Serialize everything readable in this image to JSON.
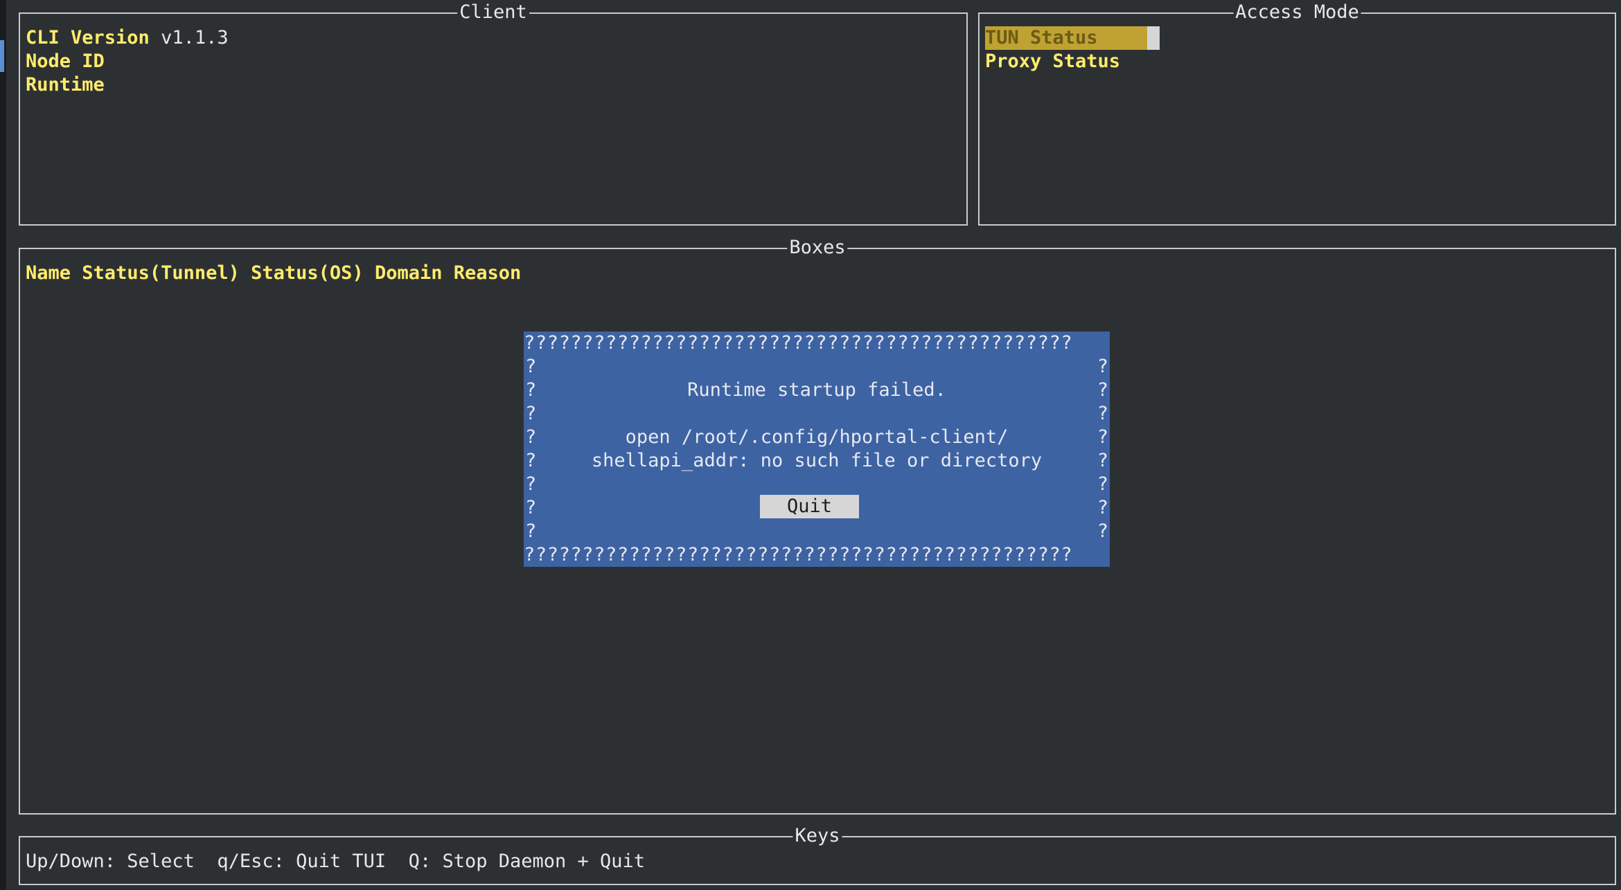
{
  "client": {
    "title": "Client",
    "cli_version_label": "CLI Version",
    "cli_version_value": "v1.1.3",
    "node_id_label": "Node ID",
    "runtime_label": "Runtime"
  },
  "access_mode": {
    "title": "Access Mode",
    "items": [
      {
        "label": "TUN Status"
      },
      {
        "label": "Proxy Status"
      }
    ]
  },
  "boxes": {
    "title": "Boxes",
    "columns": [
      "Name",
      "Status(Tunnel)",
      "Status(OS)",
      "Domain",
      "Reason"
    ]
  },
  "dialog": {
    "border_top": "???????????????????????????????????????????????",
    "border_bottom": "???????????????????????????????????????????????",
    "side_char": "?",
    "message": "Runtime startup failed.",
    "error_line1": "open /root/.config/hportal-client/",
    "error_line2": "shellapi_addr: no such file or directory",
    "quit_label": "Quit"
  },
  "keys": {
    "title": "Keys",
    "hint": "Up/Down: Select  q/Esc: Quit TUI  Q: Stop Daemon + Quit"
  },
  "colors": {
    "background": "#2d3033",
    "label_yellow": "#ffec6b",
    "dialog_blue": "#3d63a3",
    "highlight": "#bfa232"
  }
}
